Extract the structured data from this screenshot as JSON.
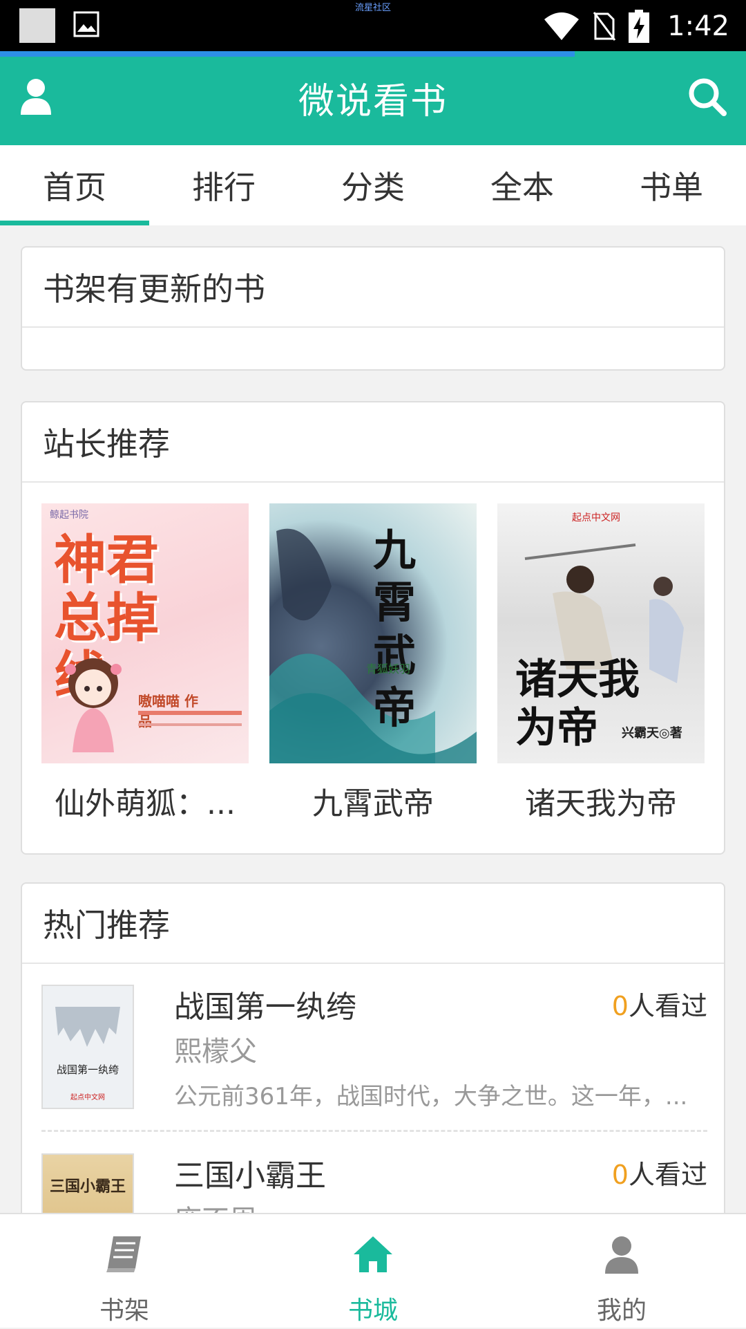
{
  "status_bar": {
    "center_text": "流星社区",
    "time": "1:42"
  },
  "load_progress": 0.77,
  "app_bar": {
    "title": "微说看书",
    "left_icon": "user-icon",
    "right_icon": "search-icon"
  },
  "tabs": [
    {
      "label": "首页",
      "active": true
    },
    {
      "label": "排行",
      "active": false
    },
    {
      "label": "分类",
      "active": false
    },
    {
      "label": "全本",
      "active": false
    },
    {
      "label": "书单",
      "active": false
    }
  ],
  "shelf_updates": {
    "title": "书架有更新的书"
  },
  "editor_picks": {
    "title": "站长推荐",
    "books": [
      {
        "title": "仙外萌狐：...",
        "cover_text": "神君总掉线",
        "cover_sub": "嗷喵喵 作品",
        "cover_publisher": "鲸起书院"
      },
      {
        "title": "九霄武帝",
        "cover_text": "九霄武帝",
        "cover_sub": "青狐妖羽"
      },
      {
        "title": "诸天我为帝",
        "cover_text": "诸天我为帝",
        "cover_sub": "兴霸天◎著",
        "cover_publisher": "起点中文网"
      }
    ]
  },
  "hot_picks": {
    "title": "热门推荐",
    "items": [
      {
        "title": "战国第一纨绔",
        "count_num": "0",
        "count_suffix": "人看过",
        "author": "熙檬父",
        "desc": "公元前361年，战国时代，大争之世。这一年，...",
        "cover_text": "战国第一纨绔",
        "cover_publisher": "起点中文网"
      },
      {
        "title": "三国小霸王",
        "count_num": "0",
        "count_suffix": "人看过",
        "author": "庞不周",
        "cover_text": "三国小霸王"
      }
    ]
  },
  "bottom_nav": [
    {
      "label": "书架",
      "icon": "book-icon",
      "active": false
    },
    {
      "label": "书城",
      "icon": "home-icon",
      "active": true
    },
    {
      "label": "我的",
      "icon": "person-icon",
      "active": false
    }
  ],
  "colors": {
    "accent": "#1aba9c",
    "count_highlight": "#f0a020",
    "progress": "#2d8fe6"
  }
}
